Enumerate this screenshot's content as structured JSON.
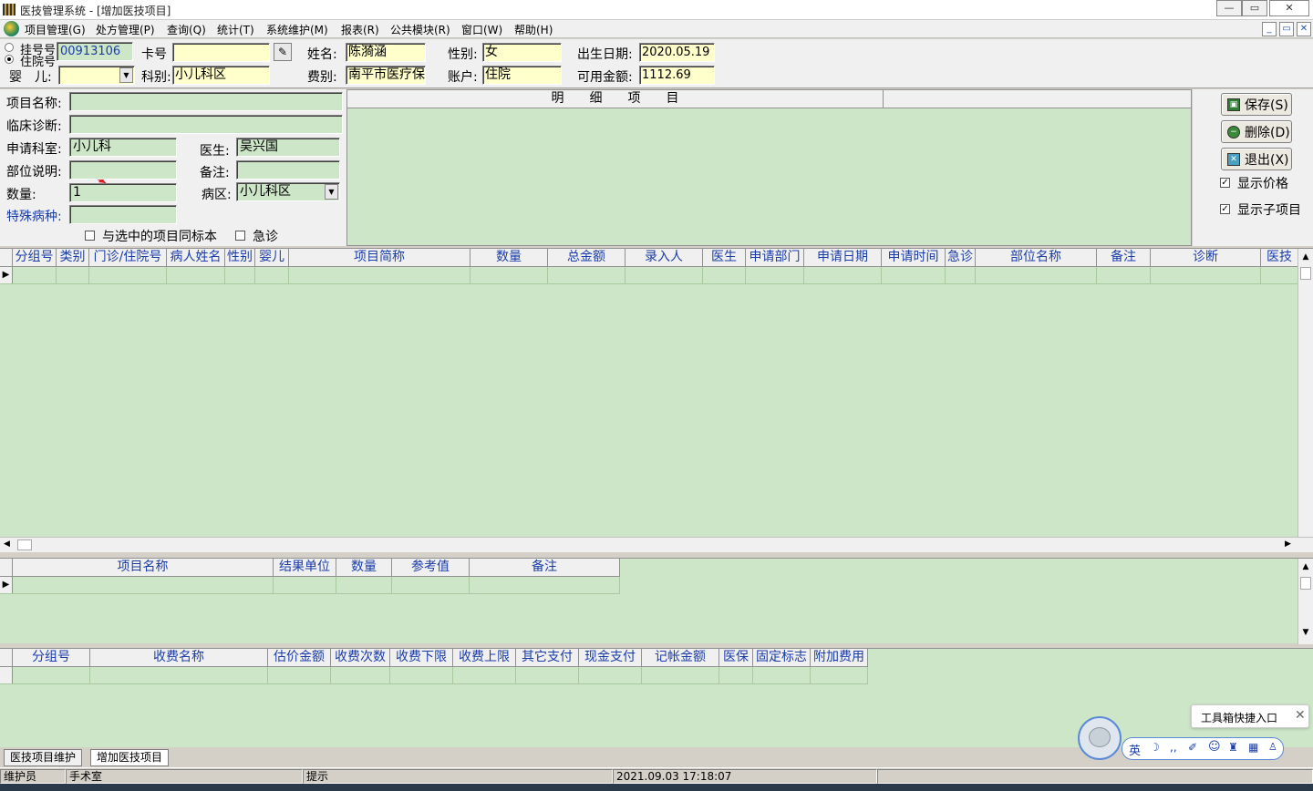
{
  "window": {
    "title": "医技管理系统 - [增加医技项目]",
    "min": "—",
    "restore": "▭",
    "close": "✕"
  },
  "menu": {
    "items": [
      "项目管理(G)",
      "处方管理(P)",
      "查询(Q)",
      "统计(T)",
      "系统维护(M)",
      "报表(R)",
      "公共模块(R)",
      "窗口(W)",
      "帮助(H)"
    ]
  },
  "patient": {
    "reg_label": "挂号号",
    "inpatient_label": "住院号",
    "id_value": "00913106",
    "card_label": "卡号",
    "card_value": "",
    "name_label": "姓名:",
    "name_value": "陈漪涵",
    "gender_label": "性别:",
    "gender_value": "女",
    "birth_label": "出生日期:",
    "birth_value": "2020.05.19",
    "baby_label": "婴　儿:",
    "baby_value": "",
    "dept_label": "科别:",
    "dept_value": "小儿科区",
    "fee_label": "费别:",
    "fee_value": "南平市医疗保",
    "account_label": "账户:",
    "account_value": "住院",
    "balance_label": "可用金额:",
    "balance_value": "1112.69"
  },
  "form": {
    "item_name_label": "项目名称:",
    "diagnosis_label": "临床诊断:",
    "apply_dept_label": "申请科室:",
    "apply_dept_value": "小儿科",
    "doctor_label": "医生:",
    "doctor_value": "吴兴国",
    "part_label": "部位说明:",
    "remark_label": "备注:",
    "qty_label": "数量:",
    "qty_value": "1",
    "ward_label": "病区:",
    "ward_value": "小儿科区",
    "special_label": "特殊病种:",
    "same_sample_label": "与选中的项目同标本",
    "emergency_label": "急诊"
  },
  "detail": {
    "header": "明　　细　　项　　目"
  },
  "buttons": {
    "save": "保存(S)",
    "delete": "删除(D)",
    "exit": "退出(X)",
    "show_price": "显示价格",
    "show_sub": "显示子项目"
  },
  "grid1": {
    "columns": [
      "分组号",
      "类别",
      "门诊/住院号",
      "病人姓名",
      "性别",
      "婴儿",
      "项目简称",
      "数量",
      "总金额",
      "录入人",
      "医生",
      "申请部门",
      "申请日期",
      "申请时间",
      "急诊",
      "部位名称",
      "备注",
      "诊断",
      "医技"
    ]
  },
  "grid2": {
    "columns": [
      "项目名称",
      "结果单位",
      "数量",
      "参考值",
      "备注"
    ]
  },
  "grid3": {
    "columns": [
      "分组号",
      "收费名称",
      "估价金额",
      "收费次数",
      "收费下限",
      "收费上限",
      "其它支付",
      "现金支付",
      "记帐金额",
      "医保",
      "固定标志",
      "附加费用"
    ]
  },
  "tabs": [
    "医技项目维护",
    "增加医技项目"
  ],
  "status": {
    "user": "维护员",
    "room": "手术室",
    "hint": "提示",
    "datetime": "2021.09.03 17:18:07"
  },
  "toolbox": {
    "label": "工具箱快捷入口",
    "ime": "英"
  }
}
